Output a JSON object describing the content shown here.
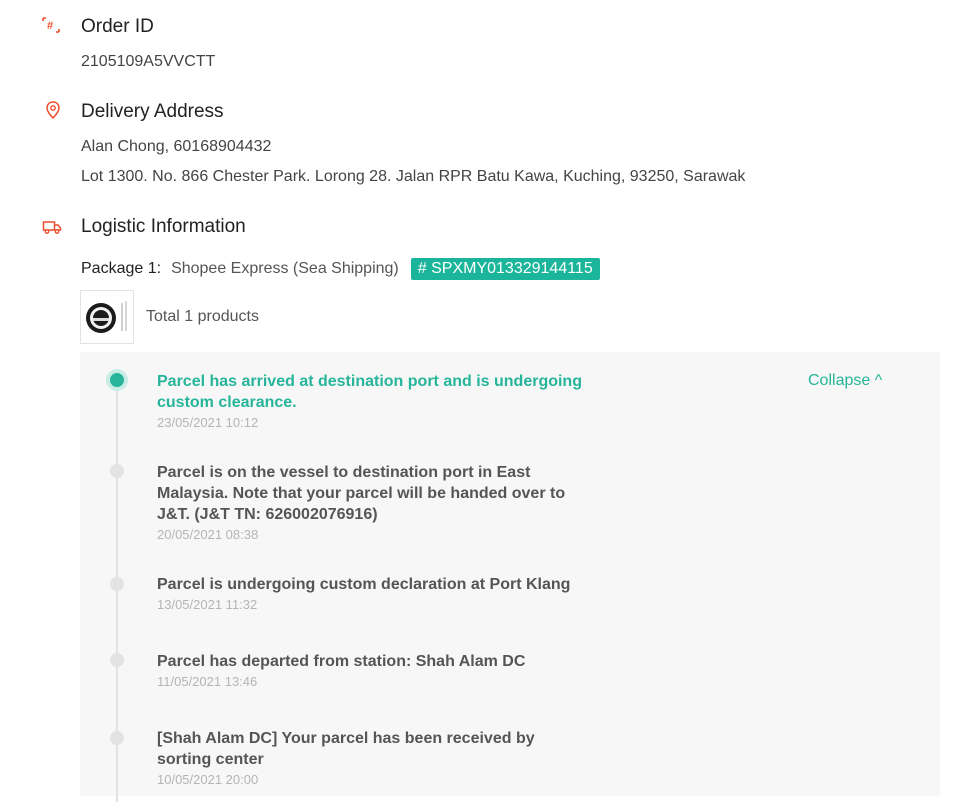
{
  "order": {
    "title": "Order ID",
    "value": "2105109A5VVCTT",
    "icon": "hash-icon"
  },
  "address": {
    "title": "Delivery Address",
    "name_phone": "Alan Chong, 60168904432",
    "line": "Lot 1300. No. 866 Chester Park. Lorong 28. Jalan RPR Batu Kawa, Kuching, 93250, Sarawak",
    "icon": "location-pin-icon"
  },
  "logistic": {
    "title": "Logistic Information",
    "icon": "truck-icon",
    "package_label": "Package 1:",
    "carrier": "Shopee Express (Sea Shipping)",
    "tracking": "# SPXMY013329144115",
    "products_text": "Total 1 products",
    "collapse_label": "Collapse ^"
  },
  "timeline": [
    {
      "desc": "Parcel has arrived at destination port and is undergoing custom clearance.",
      "time": "23/05/2021 10:12",
      "active": true
    },
    {
      "desc": "Parcel is on the vessel to destination port in East Malaysia. Note that your parcel will be handed over to J&T. (J&T TN: 626002076916)",
      "time": "20/05/2021 08:38",
      "active": false
    },
    {
      "desc": "Parcel is undergoing custom declaration at Port Klang",
      "time": "13/05/2021 11:32",
      "active": false
    },
    {
      "desc": "Parcel has departed from station: Shah Alam DC",
      "time": "11/05/2021 13:46",
      "active": false
    },
    {
      "desc": "[Shah Alam DC] Your parcel has been received by sorting center",
      "time": "10/05/2021 20:00",
      "active": false
    }
  ],
  "colors": {
    "accent": "#26b59a",
    "icon_orange": "#ee4d2d",
    "panel_bg": "#f7f7f7"
  }
}
